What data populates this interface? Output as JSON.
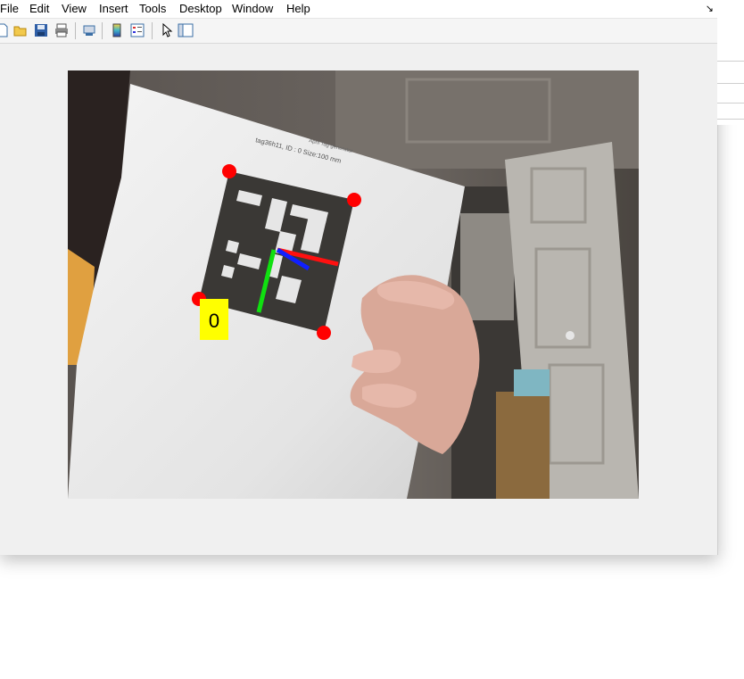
{
  "menubar": {
    "items": [
      {
        "label": "File"
      },
      {
        "label": "Edit"
      },
      {
        "label": "View"
      },
      {
        "label": "Insert"
      },
      {
        "label": "Tools"
      },
      {
        "label": "Desktop"
      },
      {
        "label": "Window"
      },
      {
        "label": "Help"
      }
    ]
  },
  "toolbar": {
    "buttons": [
      {
        "icon": "new-figure-icon"
      },
      {
        "icon": "open-file-icon"
      },
      {
        "icon": "save-icon"
      },
      {
        "icon": "print-icon"
      },
      {
        "icon": "link-plot-icon"
      },
      {
        "icon": "insert-colorbar-icon"
      },
      {
        "icon": "insert-legend-icon"
      },
      {
        "icon": "edit-plot-pointer-icon"
      },
      {
        "icon": "show-plot-tools-icon"
      }
    ]
  },
  "image": {
    "paper_header_line1": "April Tag generator",
    "paper_header_line2": "tag36h11, ID : 0 Size:100 mm",
    "tag_id_label": "0",
    "axis_colors": {
      "x": "#ff1010",
      "y": "#10e010",
      "z": "#1020ff"
    },
    "corner_color": "#ff0000",
    "label_bg": "#ffff00"
  }
}
